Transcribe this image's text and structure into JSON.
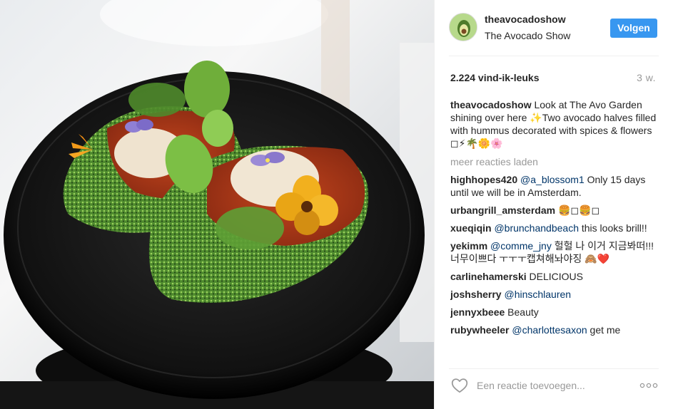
{
  "header": {
    "username": "theavocadoshow",
    "full_name": "The Avocado Show",
    "follow_label": "Volgen"
  },
  "stats": {
    "likes": "2.224 vind-ik-leuks",
    "time_ago": "3 w."
  },
  "caption": {
    "username": "theavocadoshow",
    "text": "Look at The Avo Garden shining over here ✨Two avocado halves filled with hummus decorated with spices & flowers ◻⚡🌴🌼🌸"
  },
  "load_more_label": "meer reacties laden",
  "comments": [
    {
      "username": "highhopes420",
      "mention": "@a_blossom1",
      "text": " Only 15 days until we will be in Amsterdam."
    },
    {
      "username": "urbangrill_amsterdam",
      "mention": "",
      "text": "🍔◻🍔◻"
    },
    {
      "username": "xueqiqin",
      "mention": "@brunchandbeach",
      "text": " this looks brill!!"
    },
    {
      "username": "yekimm",
      "mention": "@comme_jny",
      "text": " 헐헐 나 이거 지금봐떠!!! 너무이쁘다 ㅜㅜㅜ캡쳐해놔야징 🙈❤️"
    },
    {
      "username": "carlinehamerski",
      "mention": "",
      "text": "DELICIOUS"
    },
    {
      "username": "joshsherry",
      "mention": "@hinschlauren",
      "text": ""
    },
    {
      "username": "jennyxbeee",
      "mention": "",
      "text": "Beauty"
    },
    {
      "username": "rubywheeler",
      "mention": "@charlottesaxon",
      "text": " get me"
    }
  ],
  "comment_box": {
    "placeholder": "Een reactie toevoegen..."
  },
  "colors": {
    "accent": "#3897f0",
    "mention": "#003569",
    "muted": "#999999",
    "text": "#262626"
  },
  "icons": {
    "like": "heart-outline-icon",
    "options": "more-horizontal-icon"
  }
}
